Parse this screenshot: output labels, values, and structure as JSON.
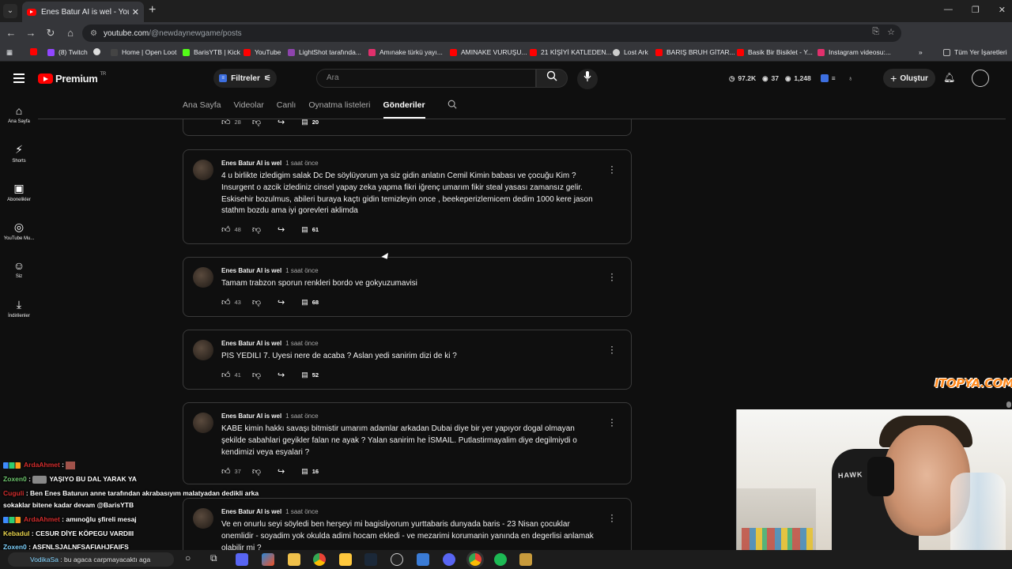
{
  "browser": {
    "tab_title": "Enes Batur AI is wel - YouTube",
    "url_host": "youtube.com",
    "url_path": "/@newdaynewgame/posts",
    "bookmarks": [
      {
        "label": "",
        "color": "#ff0000"
      },
      {
        "label": "(8) Twitch",
        "color": "#9146ff"
      },
      {
        "label": "",
        "color": "#dddddd"
      },
      {
        "label": "Home | Open Loot",
        "color": "#444444"
      },
      {
        "label": "BarisYTB | Kick",
        "color": "#53fc18"
      },
      {
        "label": "YouTube",
        "color": "#ff0000"
      },
      {
        "label": "LightShot tarafında...",
        "color": "#8e44ad"
      },
      {
        "label": "Amınake türkü yayı...",
        "color": "#e1306c"
      },
      {
        "label": "AMINAKE VURUŞU...",
        "color": "#ff0000"
      },
      {
        "label": "21 KİŞİYİ KATLEDEN...",
        "color": "#ff0000"
      },
      {
        "label": "Lost Ark",
        "color": "#cccccc"
      },
      {
        "label": "BARIŞ BRUH GİTAR...",
        "color": "#ff0000"
      },
      {
        "label": "Basik Bir Bisiklet - Y...",
        "color": "#ff0000"
      },
      {
        "label": "Instagram videosu:...",
        "color": "#e1306c"
      }
    ],
    "all_bookmarks": "Tüm Yer İşaretleri"
  },
  "header": {
    "logo_text": "Premium",
    "region": "TR",
    "filter_label": "Filtreler",
    "search_placeholder": "Ara",
    "stats": [
      "97.2K",
      "37",
      "1,248"
    ],
    "create_label": "Oluştur"
  },
  "sidebar": {
    "items": [
      {
        "label": "Ana Sayfa",
        "icon": "home-icon"
      },
      {
        "label": "Shorts",
        "icon": "shorts-icon"
      },
      {
        "label": "Abonelikler",
        "icon": "subscriptions-icon"
      },
      {
        "label": "YouTube Mu...",
        "icon": "youtube-music-icon"
      },
      {
        "label": "Siz",
        "icon": "you-icon"
      },
      {
        "label": "İndirilenler",
        "icon": "downloads-icon"
      }
    ]
  },
  "channel_tabs": [
    "Ana Sayfa",
    "Videolar",
    "Canlı",
    "Oynatma listeleri",
    "Gönderiler"
  ],
  "top_partial_post": {
    "likes": "28",
    "comments": "20"
  },
  "posts": [
    {
      "author": "Enes Batur AI is wel",
      "time": "1 saat önce",
      "text": "4 u birlikte izledigim salak Dc De söylüyorum ya siz gidin anlatın Cemil Kimin babası ve çocuğu Kim ? Insurgent o azcik izlediniz cinsel yapay zeka yapma fikri iğrenç umarım fikir steal yasası zamansız gelir. Eskisehir bozulmus, abileri buraya kaçtı gidin temizleyin once , beekeperizlemicem dedim 1000 kere jason stathm bozdu ama iyi gorevleri aklimda",
      "likes": "48",
      "comments": "61"
    },
    {
      "author": "Enes Batur AI is wel",
      "time": "1 saat önce",
      "text": "Tamam trabzon sporun renkleri bordo ve gokyuzumavisi",
      "likes": "43",
      "comments": "68"
    },
    {
      "author": "Enes Batur AI is wel",
      "time": "1 saat önce",
      "text": "PIS YEDILI 7. Uyesi nere de acaba ? Aslan yedi sanirim dizi de ki ?",
      "likes": "41",
      "comments": "52"
    },
    {
      "author": "Enes Batur AI is wel",
      "time": "1 saat önce",
      "text": "KABE kimin hakkı savaşı bitmistir umarım adamlar arkadan Dubai diye bir yer yapıyor dogal olmayan şekilde sabahlari geyikler falan ne ayak ? Yalan sanirim he İSMAIL. Putlastirmayalim diye degilmiydi o kendimizi  veya esyalari ?",
      "likes": "37",
      "comments": "16"
    },
    {
      "author": "Enes Batur AI is wel",
      "time": "1 saat önce",
      "text": "Ve en onurlu seyi söyledi ben herşeyi mi bagisliyorum yurttabaris dunyada baris - 23 Nisan çocuklar onemlidir - soyadim yok okulda adimi hocam ekledi - ve mezarimi korumanin yanında en degerlisi anlamak olabilir mi ?",
      "likes": "",
      "comments": ""
    }
  ],
  "chat": [
    {
      "nick": "ArdaAhmet",
      "nick_color": "red",
      "msg": ""
    },
    {
      "nick": "Zoxen0",
      "nick_color": "green",
      "msg": "YAŞIYO BU DAL YARAK YA"
    },
    {
      "nick": "Cuguli",
      "nick_color": "red",
      "msg": "Ben Enes Baturun anne tarafından akrabasıyım malatyadan dedikli arka"
    },
    {
      "nick": "",
      "nick_color": "red",
      "msg": "sokaklar bitene kadar devam @BarisYTB"
    },
    {
      "nick": "ArdaAhmet",
      "nick_color": "red",
      "msg": "amınoğlu şfireli mesaj"
    },
    {
      "nick": "Kebadul",
      "nick_color": "yellow",
      "msg": "CESUR DİYE KÖPEGU VARDIII"
    },
    {
      "nick": "Zoxen0",
      "nick_color": "green",
      "msg": "ASFNLSJALNFSAFIAHJFAIFS"
    }
  ],
  "taskbar_chat": {
    "nick": "VodikaSa",
    "msg": "bu agaca carpmayacaktı aga"
  },
  "watermark": "ITOPYA.COM",
  "webcam_label": "HAWK"
}
